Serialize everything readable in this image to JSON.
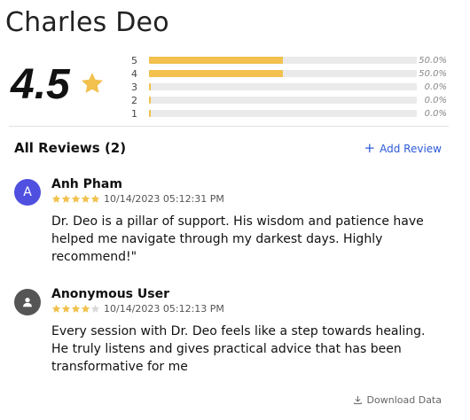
{
  "page": {
    "title": "Charles Deo"
  },
  "rating": {
    "average": "4.5",
    "star_color": "#f2c14e",
    "distribution": [
      {
        "star": "5",
        "fraction": 0.5,
        "percent_label": "50.0%"
      },
      {
        "star": "4",
        "fraction": 0.5,
        "percent_label": "50.0%"
      },
      {
        "star": "3",
        "fraction": 0.0,
        "percent_label": "0.0%"
      },
      {
        "star": "2",
        "fraction": 0.0,
        "percent_label": "0.0%"
      },
      {
        "star": "1",
        "fraction": 0.0,
        "percent_label": "0.0%"
      }
    ]
  },
  "reviews_section": {
    "heading": "All Reviews (2)",
    "add_review_label": "Add Review",
    "add_review_icon": "plus-icon"
  },
  "reviews": [
    {
      "avatar_letter": "A",
      "avatar_color": "#4f4fe0",
      "name": "Anh Pham",
      "stars": 5,
      "date": "10/14/2023 05:12:31 PM",
      "text": "Dr. Deo is a pillar of support. His wisdom and patience have helped me navigate through my darkest days. Highly recommend!\""
    },
    {
      "avatar_icon": "user-icon",
      "avatar_color": "#555555",
      "name": "Anonymous User",
      "stars": 4,
      "date": "10/14/2023 05:12:13 PM",
      "text": "Every session with Dr. Deo feels like a step towards healing. He truly listens and gives practical advice that has been transformative for me"
    }
  ],
  "footer": {
    "download_label": "Download Data",
    "download_icon": "download-icon"
  }
}
